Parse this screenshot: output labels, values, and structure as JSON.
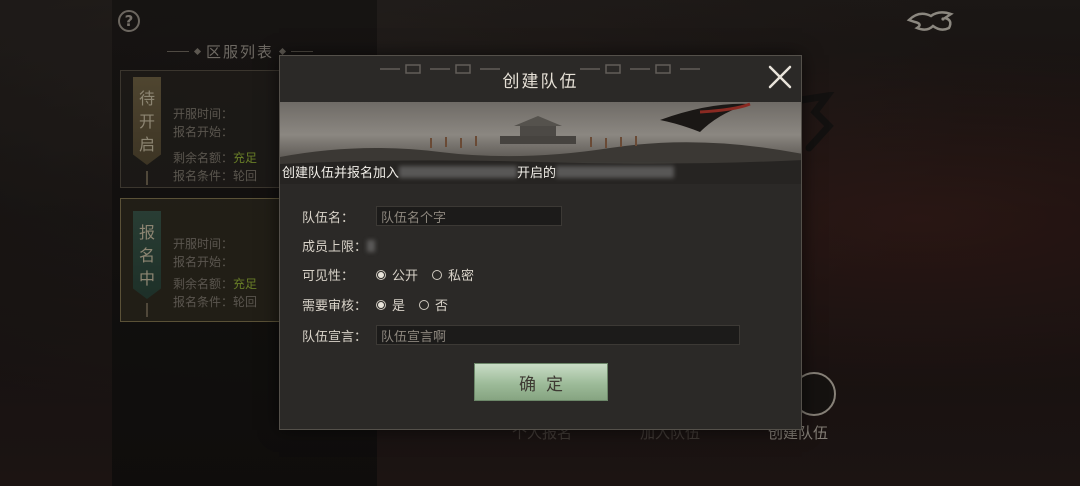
{
  "help": {
    "label": "?"
  },
  "server_list": {
    "title": "区服列表",
    "cards": [
      {
        "status": [
          "待",
          "开",
          "启"
        ],
        "lines": [
          {
            "label": "开服时间：",
            "value": ""
          },
          {
            "label": "报名开始：",
            "value": ""
          },
          {
            "label": "剩余名额：",
            "value": "充足"
          },
          {
            "label": "报名条件：",
            "value": "轮回"
          }
        ]
      },
      {
        "status": [
          "报",
          "名",
          "中"
        ],
        "lines": [
          {
            "label": "开服时间：",
            "value": ""
          },
          {
            "label": "报名开始：",
            "value": ""
          },
          {
            "label": "剩余名额：",
            "value": "充足"
          },
          {
            "label": "报名条件：",
            "value": "轮回"
          }
        ]
      }
    ]
  },
  "bottom_actions": [
    "个人报名",
    "加入队伍",
    "创建队伍"
  ],
  "dialog": {
    "title": "创建队伍",
    "caption_part1": "创建队伍并报名加入",
    "caption_part2": "开启的",
    "fields": {
      "team_name": {
        "label": "队伍名：",
        "placeholder": "队伍名个字"
      },
      "member_limit": {
        "label": "成员上限："
      },
      "visibility": {
        "label": "可见性：",
        "options": [
          "公开",
          "私密"
        ],
        "selected": "公开"
      },
      "approval": {
        "label": "需要审核：",
        "options": [
          "是",
          "否"
        ],
        "selected": "是"
      },
      "manifesto": {
        "label": "队伍宣言：",
        "placeholder": "队伍宣言啊"
      }
    },
    "confirm_label": "确定"
  },
  "colors": {
    "confirm_button": "#9dbb99",
    "status_green": "#9fbf3c",
    "dialog_bg": "#2b2927"
  }
}
